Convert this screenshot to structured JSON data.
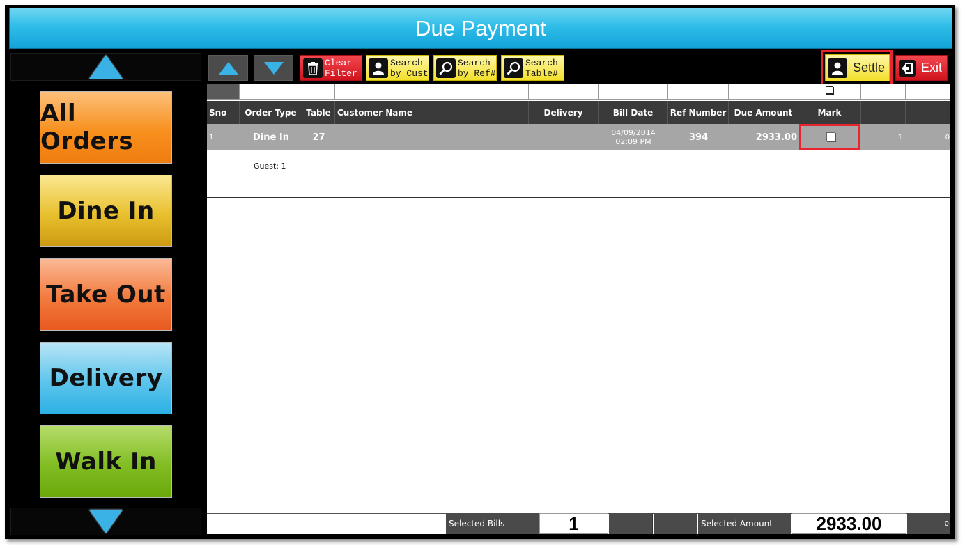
{
  "window": {
    "title": "Due Payment"
  },
  "sidebar": {
    "buttons": [
      {
        "label": "All Orders",
        "color": "#f7901e"
      },
      {
        "label": "Dine In",
        "color": "#e2b624"
      },
      {
        "label": "Take Out",
        "color": "#ef6a2c"
      },
      {
        "label": "Delivery",
        "color": "#3cb8e6"
      },
      {
        "label": "Walk In",
        "color": "#78b716"
      }
    ]
  },
  "toolbar": {
    "clear_filter": "Clear Filter",
    "clear_filter_l1": "Clear",
    "clear_filter_l2": "Filter",
    "search_cust_l1": "Search",
    "search_cust_l2": "by Cust",
    "search_ref_l1": "Search",
    "search_ref_l2": "by Ref#",
    "search_table_l1": "Search",
    "search_table_l2": "Table#",
    "settle": "Settle",
    "exit": "Exit"
  },
  "table": {
    "columns": [
      "Sno",
      "Order Type",
      "Table",
      "Customer Name",
      "Delivery",
      "Bill Date",
      "Ref Number",
      "Due Amount",
      "Mark"
    ],
    "rows": [
      {
        "sno": "1",
        "order_type": "Dine In",
        "table": "27",
        "customer_name": "",
        "delivery": "",
        "bill_date": "04/09/2014",
        "bill_time": "02:09 PM",
        "ref_number": "394",
        "due_amount": "2933.00",
        "extra1": "1",
        "extra2": "0",
        "guest": "Guest: 1"
      }
    ]
  },
  "footer": {
    "selected_bills_label": "Selected Bills",
    "selected_bills_value": "1",
    "selected_amount_label": "Selected Amount",
    "selected_amount_value": "2933.00",
    "trailing_value": "0"
  },
  "colors": {
    "title_bar": "#2fbde8",
    "highlight": "#e8252d",
    "settle_bg": "#f3df2a",
    "exit_bg": "#d0131d"
  }
}
